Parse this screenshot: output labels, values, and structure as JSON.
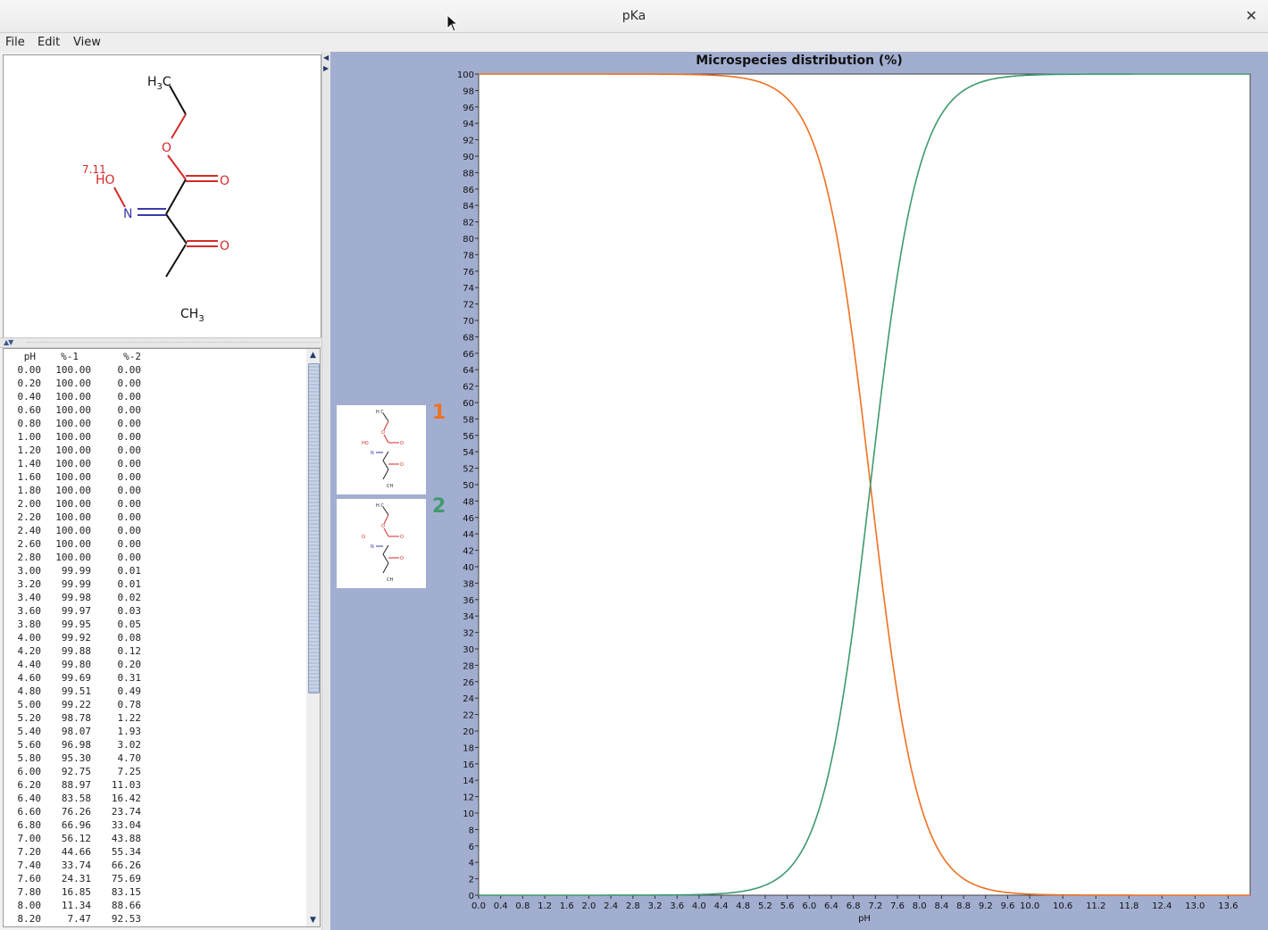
{
  "window": {
    "title": "pKa"
  },
  "menu": [
    "File",
    "Edit",
    "View"
  ],
  "molecule": {
    "atom_labels": {
      "h3c": "H",
      "h3c_sub": "3",
      "h3c_c": "C",
      "ch3": "CH",
      "ch3_sub": "3",
      "ho": "HO",
      "n": "N",
      "o_ester": "O",
      "o_carbonyl1": "O",
      "o_carbonyl2": "O"
    },
    "pka_label": "7.11"
  },
  "table": {
    "headers": [
      "pH",
      "%-1",
      "%-2"
    ],
    "rows": [
      [
        "0.00",
        "100.00",
        "0.00"
      ],
      [
        "0.20",
        "100.00",
        "0.00"
      ],
      [
        "0.40",
        "100.00",
        "0.00"
      ],
      [
        "0.60",
        "100.00",
        "0.00"
      ],
      [
        "0.80",
        "100.00",
        "0.00"
      ],
      [
        "1.00",
        "100.00",
        "0.00"
      ],
      [
        "1.20",
        "100.00",
        "0.00"
      ],
      [
        "1.40",
        "100.00",
        "0.00"
      ],
      [
        "1.60",
        "100.00",
        "0.00"
      ],
      [
        "1.80",
        "100.00",
        "0.00"
      ],
      [
        "2.00",
        "100.00",
        "0.00"
      ],
      [
        "2.20",
        "100.00",
        "0.00"
      ],
      [
        "2.40",
        "100.00",
        "0.00"
      ],
      [
        "2.60",
        "100.00",
        "0.00"
      ],
      [
        "2.80",
        "100.00",
        "0.00"
      ],
      [
        "3.00",
        "99.99",
        "0.01"
      ],
      [
        "3.20",
        "99.99",
        "0.01"
      ],
      [
        "3.40",
        "99.98",
        "0.02"
      ],
      [
        "3.60",
        "99.97",
        "0.03"
      ],
      [
        "3.80",
        "99.95",
        "0.05"
      ],
      [
        "4.00",
        "99.92",
        "0.08"
      ],
      [
        "4.20",
        "99.88",
        "0.12"
      ],
      [
        "4.40",
        "99.80",
        "0.20"
      ],
      [
        "4.60",
        "99.69",
        "0.31"
      ],
      [
        "4.80",
        "99.51",
        "0.49"
      ],
      [
        "5.00",
        "99.22",
        "0.78"
      ],
      [
        "5.20",
        "98.78",
        "1.22"
      ],
      [
        "5.40",
        "98.07",
        "1.93"
      ],
      [
        "5.60",
        "96.98",
        "3.02"
      ],
      [
        "5.80",
        "95.30",
        "4.70"
      ],
      [
        "6.00",
        "92.75",
        "7.25"
      ],
      [
        "6.20",
        "88.97",
        "11.03"
      ],
      [
        "6.40",
        "83.58",
        "16.42"
      ],
      [
        "6.60",
        "76.26",
        "23.74"
      ],
      [
        "6.80",
        "66.96",
        "33.04"
      ],
      [
        "7.00",
        "56.12",
        "43.88"
      ],
      [
        "7.20",
        "44.66",
        "55.34"
      ],
      [
        "7.40",
        "33.74",
        "66.26"
      ],
      [
        "7.60",
        "24.31",
        "75.69"
      ],
      [
        "7.80",
        "16.85",
        "83.15"
      ],
      [
        "8.00",
        "11.34",
        "88.66"
      ],
      [
        "8.20",
        "7.47",
        "92.53"
      ]
    ]
  },
  "species": [
    {
      "label": "1",
      "color": "#f07020"
    },
    {
      "label": "2",
      "color": "#3e9a6e"
    }
  ],
  "chart_data": {
    "type": "line",
    "title": "Microspecies distribution (%)",
    "xlabel": "pH",
    "ylabel": "",
    "xlim": [
      0,
      14
    ],
    "ylim": [
      0,
      100
    ],
    "pKa": 7.11,
    "x_ticks": [
      "0.0",
      "0.4",
      "0.8",
      "1.2",
      "1.6",
      "2.0",
      "2.4",
      "2.8",
      "3.2",
      "3.6",
      "4.0",
      "4.4",
      "4.8",
      "5.2",
      "5.6",
      "6.0",
      "6.4",
      "6.8",
      "7.2",
      "7.6",
      "8.0",
      "8.4",
      "8.8",
      "9.2",
      "9.6",
      "10.0",
      "10.6",
      "11.2",
      "11.8",
      "12.4",
      "13.0",
      "13.6"
    ],
    "y_ticks": [
      0,
      2,
      4,
      6,
      8,
      10,
      12,
      14,
      16,
      18,
      20,
      22,
      24,
      26,
      28,
      30,
      32,
      34,
      36,
      38,
      40,
      42,
      44,
      46,
      48,
      50,
      52,
      54,
      56,
      58,
      60,
      62,
      64,
      66,
      68,
      70,
      72,
      74,
      76,
      78,
      80,
      82,
      84,
      86,
      88,
      90,
      92,
      94,
      96,
      98,
      100
    ],
    "series": [
      {
        "name": "1",
        "color": "#f07020",
        "x": [
          0,
          1,
          2,
          3,
          3.6,
          4,
          4.4,
          4.8,
          5,
          5.2,
          5.4,
          5.6,
          5.8,
          6,
          6.2,
          6.4,
          6.6,
          6.8,
          7,
          7.2,
          7.4,
          7.6,
          7.8,
          8,
          8.2,
          8.6,
          9,
          9.4,
          10,
          11,
          12,
          14
        ],
        "y": [
          100,
          100,
          100,
          99.99,
          99.97,
          99.92,
          99.8,
          99.51,
          99.22,
          98.78,
          98.07,
          96.98,
          95.3,
          92.75,
          88.97,
          83.58,
          76.26,
          66.96,
          56.12,
          44.66,
          33.74,
          24.31,
          16.85,
          11.34,
          7.47,
          3.13,
          1.27,
          0.51,
          0.13,
          0.01,
          0,
          0
        ]
      },
      {
        "name": "2",
        "color": "#3e9a6e",
        "x": [
          0,
          1,
          2,
          3,
          3.6,
          4,
          4.4,
          4.8,
          5,
          5.2,
          5.4,
          5.6,
          5.8,
          6,
          6.2,
          6.4,
          6.6,
          6.8,
          7,
          7.2,
          7.4,
          7.6,
          7.8,
          8,
          8.2,
          8.6,
          9,
          9.4,
          10,
          11,
          12,
          14
        ],
        "y": [
          0,
          0,
          0,
          0.01,
          0.03,
          0.08,
          0.2,
          0.49,
          0.78,
          1.22,
          1.93,
          3.02,
          4.7,
          7.25,
          11.03,
          16.42,
          23.74,
          33.04,
          43.88,
          55.34,
          66.26,
          75.69,
          83.15,
          88.66,
          92.53,
          96.87,
          98.73,
          99.49,
          99.87,
          99.99,
          100,
          100
        ]
      }
    ]
  }
}
